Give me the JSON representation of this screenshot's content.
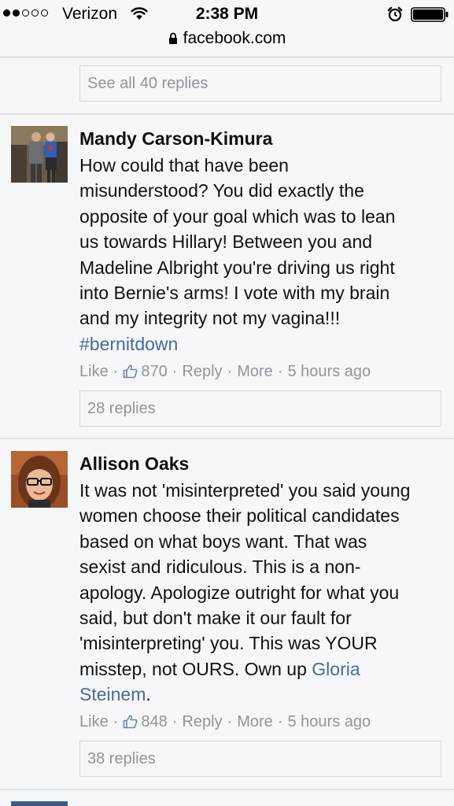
{
  "status_bar": {
    "carrier": "Verizon",
    "time": "2:38 PM",
    "signal_icon": "signal-dots-icon",
    "wifi_icon": "wifi-icon",
    "alarm_icon": "alarm-clock-icon",
    "battery_icon": "battery-icon",
    "signal_bars_filled": 2,
    "signal_bars_total": 5,
    "battery_level": 1.0
  },
  "url_bar": {
    "url": "facebook.com",
    "lock_icon": "lock-icon"
  },
  "thread": {
    "see_all_replies": "See all 40 replies",
    "comments": [
      {
        "author": "Mandy Carson-Kimura",
        "text_lines": [
          "How could that have been",
          "misunderstood? You did exactly the",
          "opposite of your goal which was to lean",
          "us towards Hillary! Between you and",
          "Madeline Albright you're driving us right",
          "into Bernie's arms! I vote with my brain",
          "and my integrity not my vagina!!!"
        ],
        "hashtag": "#bernitdown",
        "actions": {
          "like": "Like",
          "sep": "·",
          "like_count": "870",
          "reply": "Reply",
          "more": "More",
          "time": "5 hours ago"
        },
        "replies": "28 replies"
      },
      {
        "author": "Allison Oaks",
        "text_lines": [
          "It was not 'misinterpreted' you said young",
          "women choose their political candidates",
          "based on what boys want. That was",
          "sexist and ridiculous. This is a non-",
          "apology. Apologize outright for what you",
          "said, but don't make it our fault for",
          "'misinterpreting' you. This was YOUR",
          "misstep, not OURS. Own up "
        ],
        "mention_line1": "Gloria",
        "mention_line2": "Steinem",
        "mention_suffix": ".",
        "actions": {
          "like": "Like",
          "sep": "·",
          "like_count": "848",
          "reply": "Reply",
          "more": "More",
          "time": "5 hours ago"
        },
        "replies": "38 replies"
      }
    ]
  },
  "colors": {
    "link": "#4b67a1",
    "meta": "#90949c",
    "background": "#f6f7f9"
  }
}
